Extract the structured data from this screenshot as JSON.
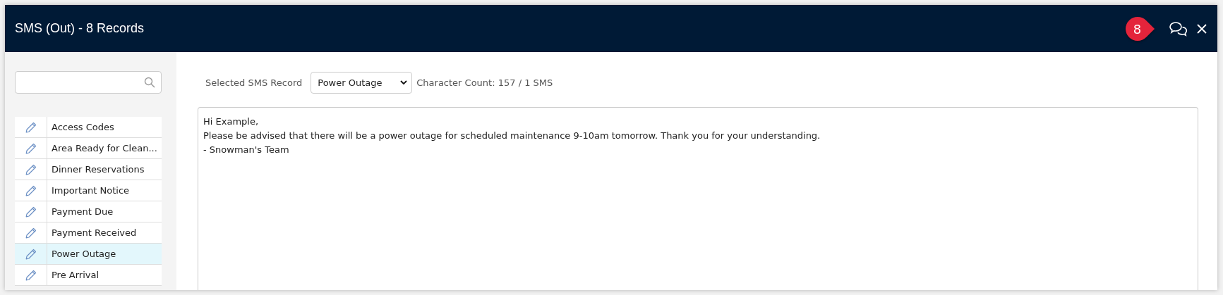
{
  "window": {
    "title": "SMS (Out) - 8 Records"
  },
  "callout": {
    "number": "8"
  },
  "sidebar": {
    "items": [
      {
        "label": "Access Codes",
        "selected": false
      },
      {
        "label": "Area Ready for Clean...",
        "selected": false
      },
      {
        "label": "Dinner Reservations",
        "selected": false
      },
      {
        "label": "Important Notice",
        "selected": false
      },
      {
        "label": "Payment Due",
        "selected": false
      },
      {
        "label": "Payment Received",
        "selected": false
      },
      {
        "label": "Power Outage",
        "selected": true
      },
      {
        "label": "Pre Arrival",
        "selected": false
      }
    ]
  },
  "editor": {
    "record_label": "Selected SMS Record",
    "record_value": "Power Outage",
    "character_count": "Character Count: 157 / 1 SMS",
    "message_lines": [
      "Hi Example,",
      "Please be advised that there will be a power outage for scheduled maintenance 9-10am tomorrow. Thank you for your understanding.",
      "- Snowman's Team"
    ]
  }
}
